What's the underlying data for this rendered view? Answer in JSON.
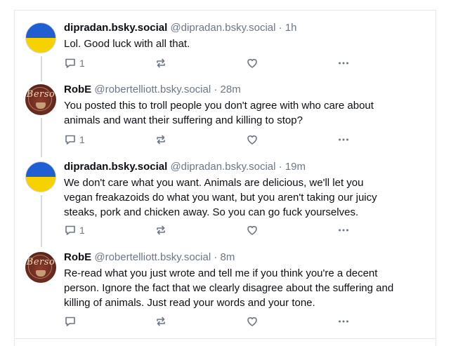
{
  "posts": [
    {
      "display_name": "dipradan.bsky.social",
      "handle": "@dipradan.bsky.social",
      "separator": "·",
      "time": "1h",
      "avatar": "ukraine-flag",
      "lines": [
        "Lol.  Good luck with all that."
      ],
      "reply_count": "1"
    },
    {
      "display_name": "RobE",
      "handle": "@robertelliott.bsky.social",
      "separator": "·",
      "time": "28m",
      "avatar": "berso-logo",
      "avatar_text": "Berso",
      "lines": [
        "You posted this to troll people you don't agree with who care about",
        "animals and want their suffering and killing to stop?"
      ],
      "reply_count": "1"
    },
    {
      "display_name": "dipradan.bsky.social",
      "handle": "@dipradan.bsky.social",
      "separator": "·",
      "time": "19m",
      "avatar": "ukraine-flag",
      "lines": [
        "We don't care what you want.  Animals are delicious, we'll let you",
        "vegan freakazoids do what you want, but you aren't taking our juicy",
        "steaks, pork and chicken away.  So you can go fuck yourselves."
      ],
      "reply_count": "1"
    },
    {
      "display_name": "RobE",
      "handle": "@robertelliott.bsky.social",
      "separator": "·",
      "time": "8m",
      "avatar": "berso-logo",
      "avatar_text": "Berso",
      "lines": [
        "Re-read what you just wrote and tell me if you think you're a decent",
        "person. Ignore the fact that we clearly disagree about the suffering and",
        "killing of animals. Just read your words and your tone."
      ],
      "reply_count": ""
    }
  ],
  "icons": {
    "reply": "speech-bubble-icon",
    "repost": "repost-arrows-icon",
    "like": "heart-icon",
    "more": "ellipsis-icon"
  },
  "colors": {
    "text": "#0b0f14",
    "muted": "#6b7785",
    "border": "#e5e8eb",
    "thread": "#d4dbe2",
    "ua_blue": "#1f5fd1",
    "ua_yellow": "#f6d200"
  }
}
